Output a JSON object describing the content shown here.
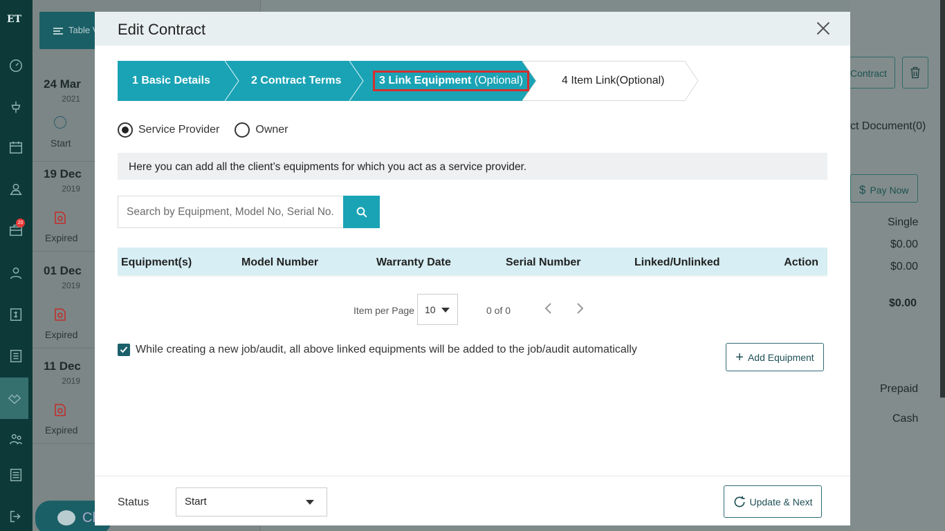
{
  "sidebar": {
    "logo": "ET",
    "notification_count": "20"
  },
  "background": {
    "table_view_label": "Table V",
    "dates": [
      {
        "day": "24 Mar",
        "year": "2021",
        "status": "Start"
      },
      {
        "day": "19 Dec",
        "year": "2019",
        "status": "Expired"
      },
      {
        "day": "01 Dec",
        "year": "2019",
        "status": "Expired"
      },
      {
        "day": "11 Dec",
        "year": "2019",
        "status": "Expired"
      }
    ],
    "chat_label": "Ch",
    "right": {
      "contract_btn": "Contract",
      "document_tab": "ct Document(0)",
      "pay_now": "Pay Now",
      "single": "Single",
      "amount1": "$0.00",
      "amount2": "$0.00",
      "total": "$0.00",
      "prepaid": "Prepaid",
      "cash": "Cash"
    }
  },
  "modal": {
    "title": "Edit Contract",
    "steps": [
      {
        "label": "1 Basic Details",
        "extra": ""
      },
      {
        "label": "2 Contract Terms",
        "extra": ""
      },
      {
        "label": "3 Link Equipment",
        "extra": " (Optional)"
      },
      {
        "label": "4 Item Link(Optional)",
        "extra": ""
      }
    ],
    "radios": {
      "service_provider": "Service Provider",
      "owner": "Owner"
    },
    "info_text": "Here you can add all the client’s equipments for which you act as a service provider.",
    "search_placeholder": "Search by Equipment, Model No, Serial No.",
    "table_headers": [
      "Equipment(s)",
      "Model Number",
      "Warranty Date",
      "Serial Number",
      "Linked/Unlinked",
      "Action"
    ],
    "pagination": {
      "items_per_page_label": "Item per Page",
      "items_per_page_value": "10",
      "range": "0 of 0"
    },
    "auto_add_text": "While creating a new job/audit, all above linked equipments will be added to the job/audit automatically",
    "add_equipment_label": "Add Equipment",
    "status_label": "Status",
    "status_value": "Start",
    "update_next_label": "Update & Next"
  },
  "colors": {
    "accent": "#1aa3b5",
    "dark_nav": "#0d3a39",
    "highlight": "#d32f2f"
  }
}
